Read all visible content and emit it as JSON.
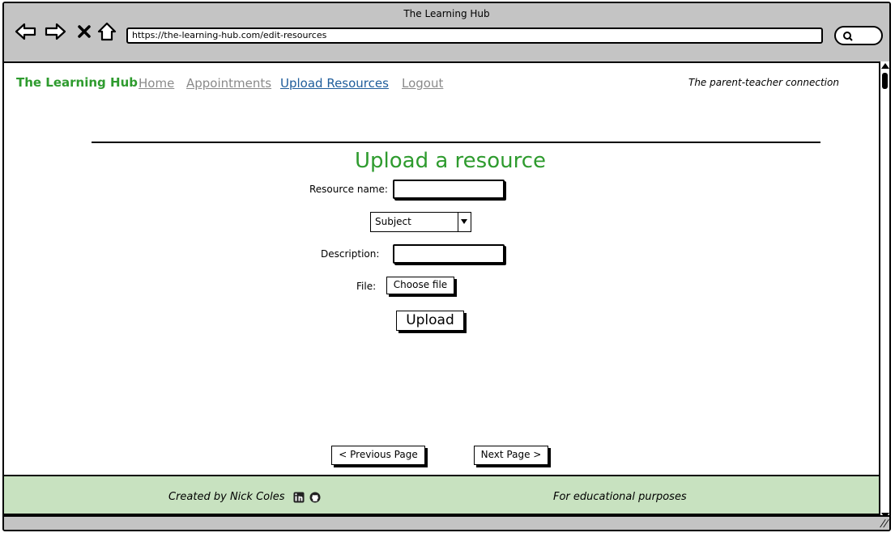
{
  "browser": {
    "window_title": "The Learning Hub",
    "url": "https://the-learning-hub.com/edit-resources"
  },
  "nav": {
    "brand": "The Learning Hub",
    "links": [
      {
        "label": "Home",
        "active": false
      },
      {
        "label": "Appointments",
        "active": false
      },
      {
        "label": "Upload Resources",
        "active": true
      },
      {
        "label": "Logout",
        "active": false
      }
    ],
    "tagline": "The parent-teacher connection"
  },
  "form": {
    "title": "Upload a resource",
    "resource_name_label": "Resource name:",
    "subject_select": "Subject",
    "description_label": "Description:",
    "file_label": "File:",
    "choose_file_label": "Choose file",
    "upload_label": "Upload"
  },
  "pagination": {
    "previous_label": "< Previous Page",
    "next_label": "Next Page >"
  },
  "footer": {
    "credit": "Created by Nick Coles",
    "purpose": "For educational purposes",
    "icons": [
      "linkedin-icon",
      "github-icon"
    ]
  },
  "colors": {
    "brand_green": "#2e9b2e",
    "active_link": "#1f5d9b",
    "inactive_link": "#8a8a8a",
    "footer_bg": "#c8e2c0",
    "chrome_gray": "#c4c4c4"
  }
}
